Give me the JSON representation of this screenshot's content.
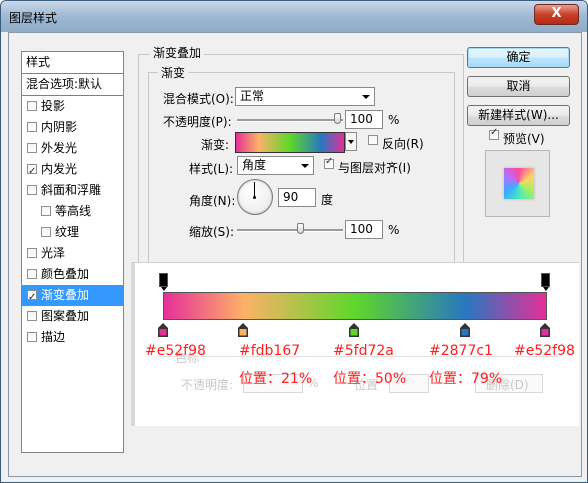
{
  "window": {
    "title": "图层样式",
    "close": "X"
  },
  "sidebar": {
    "header": "样式",
    "blend": "混合选项:默认",
    "items": [
      {
        "label": "投影",
        "checked": false
      },
      {
        "label": "内阴影",
        "checked": false
      },
      {
        "label": "外发光",
        "checked": false
      },
      {
        "label": "内发光",
        "checked": true
      },
      {
        "label": "斜面和浮雕",
        "checked": false
      },
      {
        "label": "等高线",
        "checked": false,
        "sub": true
      },
      {
        "label": "纹理",
        "checked": false,
        "sub": true
      },
      {
        "label": "光泽",
        "checked": false
      },
      {
        "label": "颜色叠加",
        "checked": false
      },
      {
        "label": "渐变叠加",
        "checked": true,
        "active": true
      },
      {
        "label": "图案叠加",
        "checked": false
      },
      {
        "label": "描边",
        "checked": false
      }
    ]
  },
  "main": {
    "section_title": "渐变叠加",
    "group_title": "渐变",
    "blend_mode_label": "混合模式(O):",
    "blend_mode_value": "正常",
    "opacity_label": "不透明度(P):",
    "opacity_value": "100",
    "opacity_unit": "%",
    "gradient_label": "渐变:",
    "reverse_label": "反向(R)",
    "style_label": "样式(L):",
    "style_value": "角度",
    "align_label": "与图层对齐(I)",
    "angle_label": "角度(N):",
    "angle_value": "90",
    "angle_unit": "度",
    "scale_label": "缩放(S):",
    "scale_value": "100",
    "scale_unit": "%"
  },
  "buttons": {
    "ok": "确定",
    "cancel": "取消",
    "new_style": "新建样式(W)...",
    "preview": "预览(V)"
  },
  "gradient_editor": {
    "stops": [
      {
        "hex": "#e52f98",
        "color": "#e52f98",
        "position": 0
      },
      {
        "hex": "#fdb167",
        "color": "#fdb167",
        "position": 21
      },
      {
        "hex": "#5fd72a",
        "color": "#5fd72a",
        "position": 50
      },
      {
        "hex": "#2877c1",
        "color": "#2877c1",
        "position": 79
      },
      {
        "hex": "#e52f98",
        "color": "#e52f98",
        "position": 100
      }
    ],
    "positions": [
      "位置：21%",
      "位置：50%",
      "位置：79%"
    ],
    "ghost": {
      "color": "色标",
      "opacity": "不透明度:",
      "percent": "%",
      "location": "位置",
      "delete": "删除(D)"
    }
  }
}
